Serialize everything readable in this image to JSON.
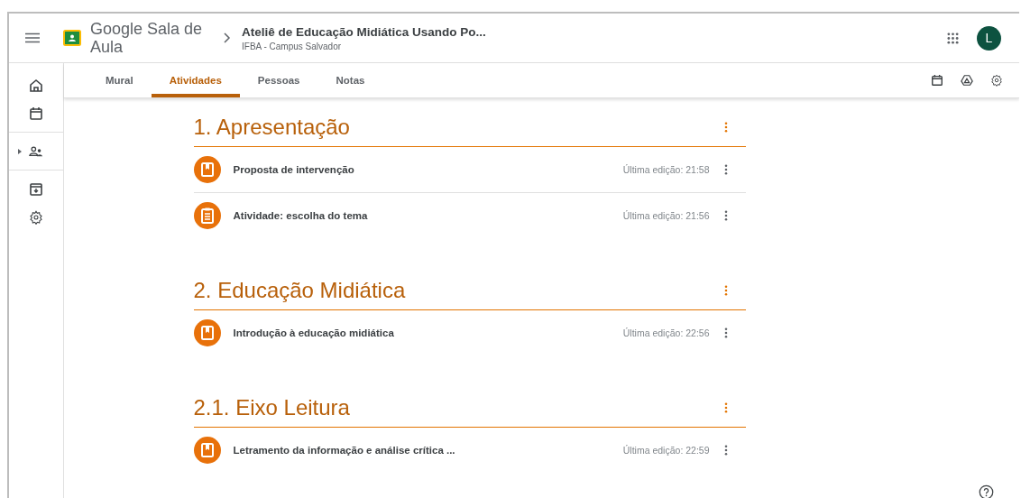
{
  "header": {
    "app_name": "Google Sala de Aula",
    "course_title": "Ateliê de Educação Midiática Usando Po...",
    "course_subtitle": "IFBA - Campus Salvador",
    "avatar_letter": "L"
  },
  "tabs": [
    {
      "label": "Mural",
      "selected": false
    },
    {
      "label": "Atividades",
      "selected": true
    },
    {
      "label": "Pessoas",
      "selected": false
    },
    {
      "label": "Notas",
      "selected": false
    }
  ],
  "sections": [
    {
      "title": "1. Apresentação",
      "items": [
        {
          "kind": "material",
          "title": "Proposta de intervenção",
          "edited": "Última edição: 21:58"
        },
        {
          "kind": "assignment",
          "title": "Atividade: escolha do tema",
          "edited": "Última edição: 21:56"
        }
      ]
    },
    {
      "title": "2. Educação Midiática",
      "items": [
        {
          "kind": "material",
          "title": "Introdução à educação midiática",
          "edited": "Última edição: 22:56"
        }
      ]
    },
    {
      "title": "2.1. Eixo Leitura",
      "items": [
        {
          "kind": "material",
          "title": "Letramento da informação e análise crítica ...",
          "edited": "Última edição: 22:59"
        }
      ]
    }
  ]
}
